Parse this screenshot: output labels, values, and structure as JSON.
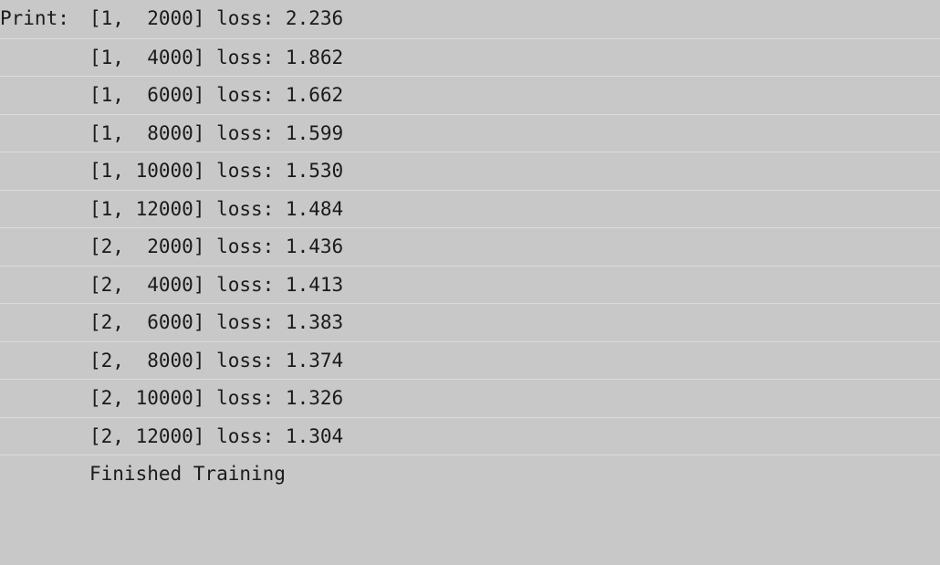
{
  "console": {
    "prefix": "Print:",
    "lines": [
      "[1,  2000] loss: 2.236",
      "[1,  4000] loss: 1.862",
      "[1,  6000] loss: 1.662",
      "[1,  8000] loss: 1.599",
      "[1, 10000] loss: 1.530",
      "[1, 12000] loss: 1.484",
      "[2,  2000] loss: 1.436",
      "[2,  4000] loss: 1.413",
      "[2,  6000] loss: 1.383",
      "[2,  8000] loss: 1.374",
      "[2, 10000] loss: 1.326",
      "[2, 12000] loss: 1.304",
      "Finished Training"
    ]
  }
}
